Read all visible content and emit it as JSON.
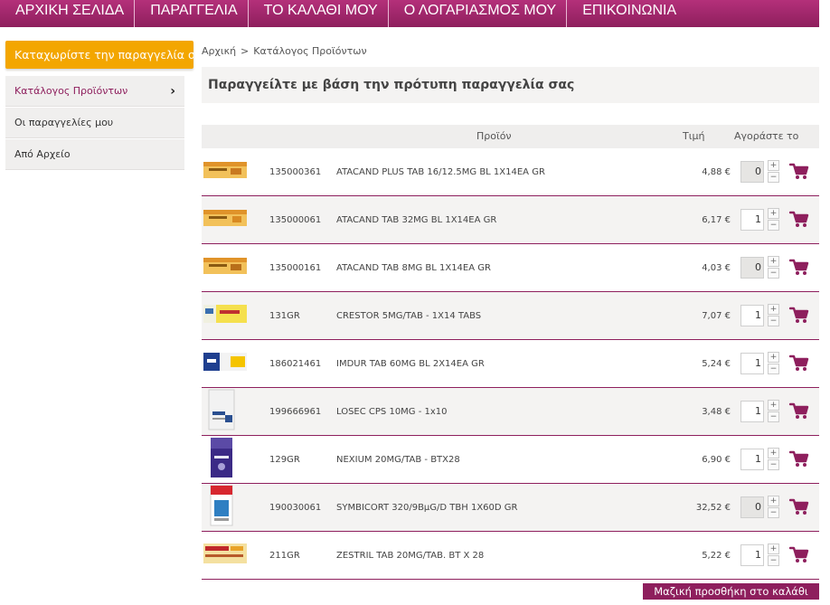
{
  "nav": [
    "ΑΡΧΙΚΗ ΣΕΛΙΔΑ",
    "ΠΑΡΑΓΓΕΛΙΑ",
    "ΤΟ ΚΑΛΑΘΙ ΜΟΥ",
    "Ο ΛΟΓΑΡΙΑΣΜΟΣ ΜΟΥ",
    "ΕΠΙΚΟΙΝΩΝΙΑ"
  ],
  "cta_label": "Καταχωρίστε την παραγγελία σας",
  "sidebar": {
    "items": [
      {
        "label": "Κατάλογος Προϊόντων"
      },
      {
        "label": "Οι παραγγελίες μου"
      },
      {
        "label": "Από Αρχείο"
      }
    ]
  },
  "breadcrumb": {
    "home": "Αρχική",
    "separator": ">",
    "current": "Κατάλογος Προϊόντων"
  },
  "page_title": "Παραγγείλτε με βάση την πρότυπη παραγγελία σας",
  "table": {
    "headers": {
      "product": "Προϊόν",
      "price": "Τιμή",
      "buy": "Αγοράστε το"
    },
    "rows": [
      {
        "code": "135000361",
        "name": "ATACAND PLUS TAB 16/12.5MG BL 1X14EA GR",
        "price": "4,88 €",
        "qty": "0"
      },
      {
        "code": "135000061",
        "name": "ATACAND TAB 32MG BL 1X14EA GR",
        "price": "6,17 €",
        "qty": "1"
      },
      {
        "code": "135000161",
        "name": "ATACAND TAB 8MG BL 1X14EA GR",
        "price": "4,03 €",
        "qty": "0"
      },
      {
        "code": "131GR",
        "name": "CRESTOR 5MG/TAB - 1X14 TABS",
        "price": "7,07 €",
        "qty": "1"
      },
      {
        "code": "186021461",
        "name": "IMDUR TAB 60MG BL 2X14EA GR",
        "price": "5,24 €",
        "qty": "1"
      },
      {
        "code": "199666961",
        "name": "LOSEC CPS 10MG - 1x10",
        "price": "3,48 €",
        "qty": "1"
      },
      {
        "code": "129GR",
        "name": "NEXIUM 20MG/TAB - BTX28",
        "price": "6,90 €",
        "qty": "1"
      },
      {
        "code": "190030061",
        "name": "SYMBICORT 320/9ΒμG/D TBH 1X60D GR",
        "price": "32,52 €",
        "qty": "0"
      },
      {
        "code": "211GR",
        "name": "ZESTRIL TAB 20MG/TAB. BT X 28",
        "price": "5,22 €",
        "qty": "1"
      }
    ]
  },
  "bulk_add_label": "Μαζική προσθήκη στο καλάθι",
  "colors": {
    "brand": "#8e1f5d",
    "accent": "#f3a600"
  }
}
